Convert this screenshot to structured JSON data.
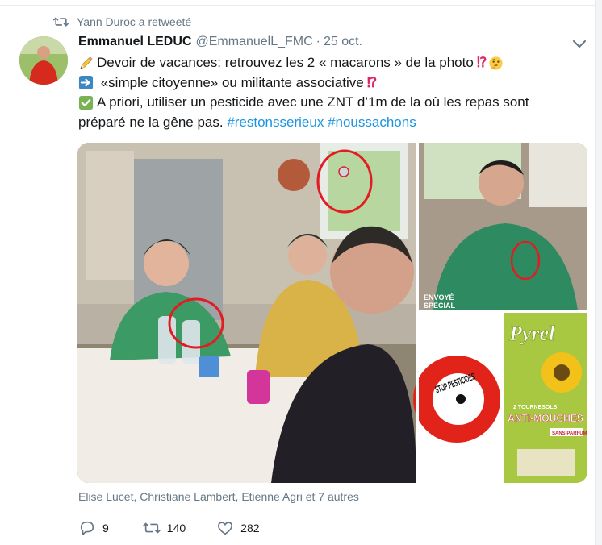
{
  "retweet": {
    "icon": "retweet-icon",
    "text": "Yann Duroc a retweeté"
  },
  "tweet": {
    "author_name": "Emmanuel LEDUC",
    "author_handle": "@EmmanuelL_FMC",
    "separator": "·",
    "date": "25 oct.",
    "lines": [
      {
        "icon": "pencil-emoji",
        "text": "Devoir de vacances: retrouvez les 2 « macarons » de la photo",
        "suffix": "⁉",
        "suffix_icon": "thinking-face-emoji"
      },
      {
        "icon": "right-arrow-emoji",
        "text": " «simple citoyenne» ou militante associative",
        "suffix": "⁉"
      },
      {
        "icon": "check-mark-button-emoji",
        "text": "A priori, utiliser un pesticide avec une ZNT d’1m de la où les repas sont"
      },
      {
        "text": "préparé ne la gêne pas. ",
        "hashtag1": "#restonsserieux",
        "hashtag2": "#noussachons"
      }
    ]
  },
  "media": {
    "overlay_text_1": "ENVOYÉ",
    "overlay_text_2": "SPÉCIAL",
    "stop_sticker_text": "STOP PESTICIDES",
    "pyrel_brand": "Pyrel",
    "pyrel_line1": "2 TOURNESOLS",
    "pyrel_line2": "ANTI-MOUCHES",
    "pyrel_tag": "SANS PARFUM"
  },
  "likers": "Elise Lucet, Christiane Lambert, Etienne Agri et 7 autres",
  "actions": {
    "reply_count": "9",
    "retweet_count": "140",
    "like_count": "282"
  },
  "colors": {
    "link": "#1b95e0",
    "muted": "#657786",
    "red_highlight": "#e0245e"
  }
}
